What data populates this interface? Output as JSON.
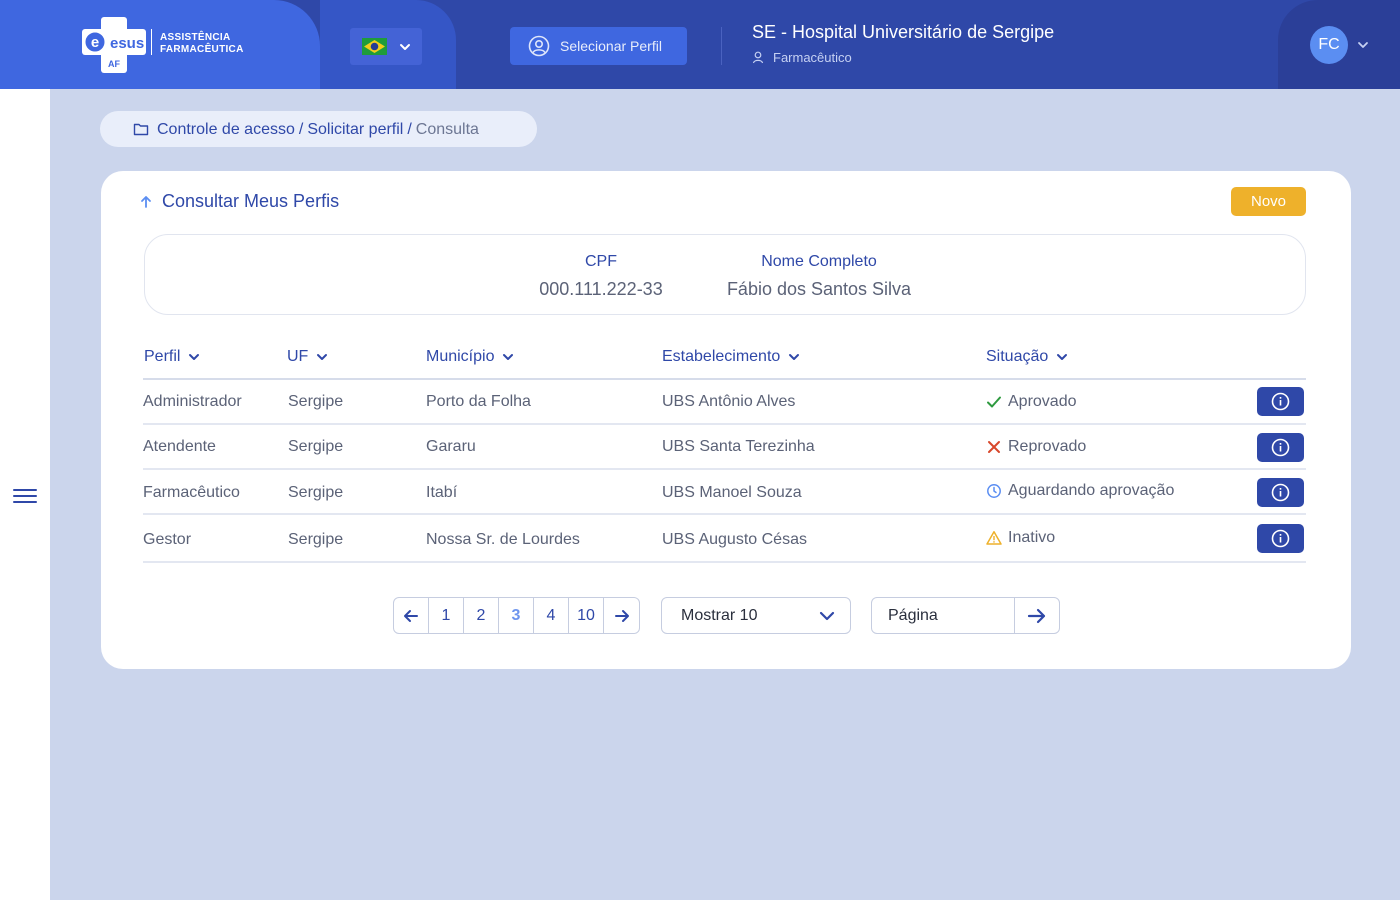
{
  "header": {
    "logo_name": "esus",
    "logo_sub": "AF",
    "logo_line1": "ASSISTÊNCIA",
    "logo_line2": "FARMACÊUTICA",
    "select_profile_label": "Selecionar Perfil",
    "hospital": "SE - Hospital Universitário de Sergipe",
    "role": "Farmacêutico",
    "avatar_initials": "FC",
    "colors": {
      "primary": "#2f48a8",
      "accent": "#3f67e0"
    }
  },
  "breadcrumb": {
    "items": [
      "Controle de acesso",
      "Solicitar perfil"
    ],
    "current": "Consulta",
    "separator": "/"
  },
  "card": {
    "title": "Consultar Meus Perfis",
    "new_button": "Novo",
    "cpf_label": "CPF",
    "cpf_value": "000.111.222-33",
    "name_label": "Nome Completo",
    "name_value": "Fábio dos Santos Silva"
  },
  "table": {
    "columns": [
      "Perfil",
      "UF",
      "Município",
      "Estabelecimento",
      "Situação"
    ],
    "rows": [
      {
        "perfil": "Administrador",
        "uf": "Sergipe",
        "municipio": "Porto da Folha",
        "estabelecimento": "UBS Antônio Alves",
        "situacao": "Aprovado",
        "status_icon": "check-icon",
        "status_color": "#2e9a3f"
      },
      {
        "perfil": "Atendente",
        "uf": "Sergipe",
        "municipio": "Gararu",
        "estabelecimento": "UBS Santa Terezinha",
        "situacao": "Reprovado",
        "status_icon": "x-icon",
        "status_color": "#d8472b"
      },
      {
        "perfil": "Farmacêutico",
        "uf": "Sergipe",
        "municipio": "Itabí",
        "estabelecimento": "UBS Manoel Souza",
        "situacao": "Aguardando aprovação",
        "status_icon": "clock-icon",
        "status_color": "#5b8ef2"
      },
      {
        "perfil": "Gestor",
        "uf": "Sergipe",
        "municipio": "Nossa Sr. de Lourdes",
        "estabelecimento": "UBS Augusto Césas",
        "situacao": "Inativo",
        "status_icon": "warning-icon",
        "status_color": "#eeb12b"
      }
    ]
  },
  "pagination": {
    "pages": [
      "1",
      "2",
      "3",
      "4",
      "10"
    ],
    "current": "3",
    "page_size_label": "Mostrar 10",
    "goto_placeholder": "Página"
  }
}
